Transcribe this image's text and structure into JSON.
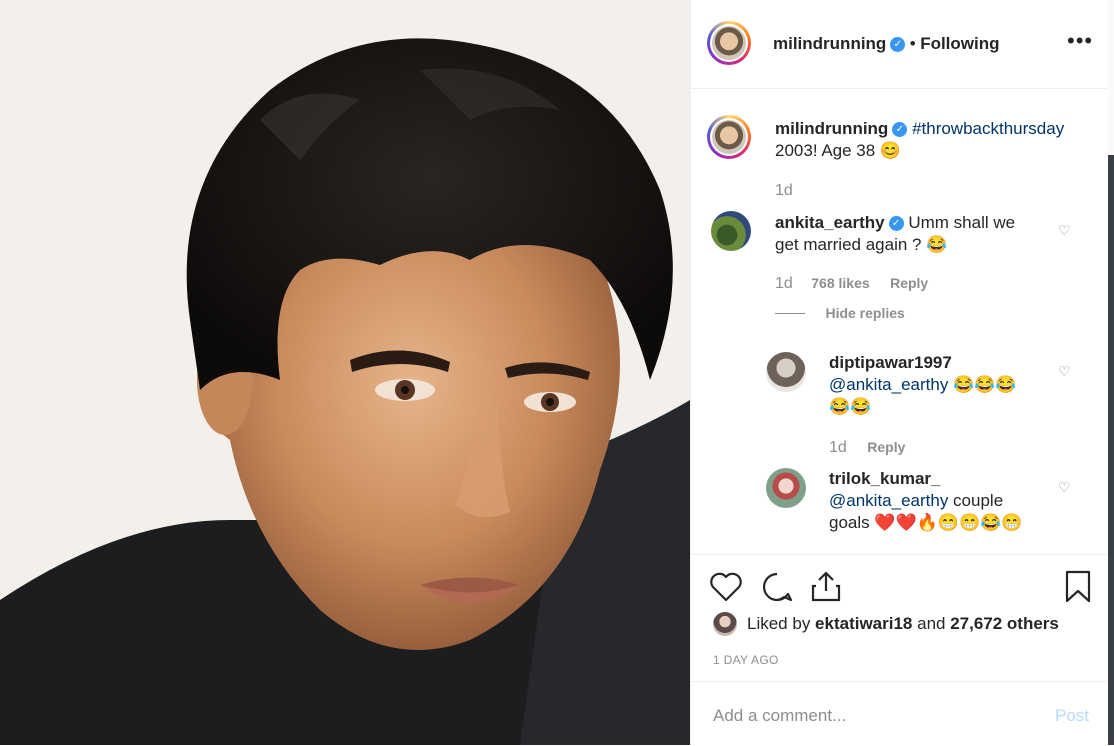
{
  "post": {
    "author": "milindrunning",
    "follow_separator": "•",
    "follow_status": "Following",
    "more_label": "•••",
    "verified_glyph": "✓"
  },
  "caption": {
    "author": "milindrunning",
    "hashtag": "#throwbackthursday",
    "text": "2003! Age 38 😊",
    "age": "1d"
  },
  "comments": [
    {
      "author": "ankita_earthy",
      "verified": true,
      "text_line1": "Umm shall we",
      "text_line2": "get married again ? 😂",
      "age": "1d",
      "likes": "768 likes",
      "reply_label": "Reply",
      "hide_replies": "Hide replies",
      "replies": [
        {
          "author": "diptipawar1997",
          "mention": "@ankita_earthy",
          "text_line1": " 😂😂😂",
          "text_line2": "😂😂",
          "age": "1d",
          "reply_label": "Reply"
        },
        {
          "author": "trilok_kumar_",
          "mention": "@ankita_earthy",
          "text_line1": " couple",
          "text_line2": "goals ❤️❤️🔥😁😁😂😁"
        }
      ]
    }
  ],
  "likes_line": {
    "prefix": "Liked by ",
    "user": "ektatiwari18",
    "middle": " and ",
    "count": "27,672 others"
  },
  "timestamp": "1 DAY AGO",
  "comment_box": {
    "placeholder": "Add a comment...",
    "post_label": "Post"
  },
  "icons": {
    "like": "heart-icon",
    "comment": "comment-icon",
    "share": "share-icon",
    "save": "bookmark-icon"
  },
  "colors": {
    "link": "#003569",
    "verified": "#3897f0",
    "muted": "#8e8e8e",
    "post_disabled": "#b3dbff"
  }
}
